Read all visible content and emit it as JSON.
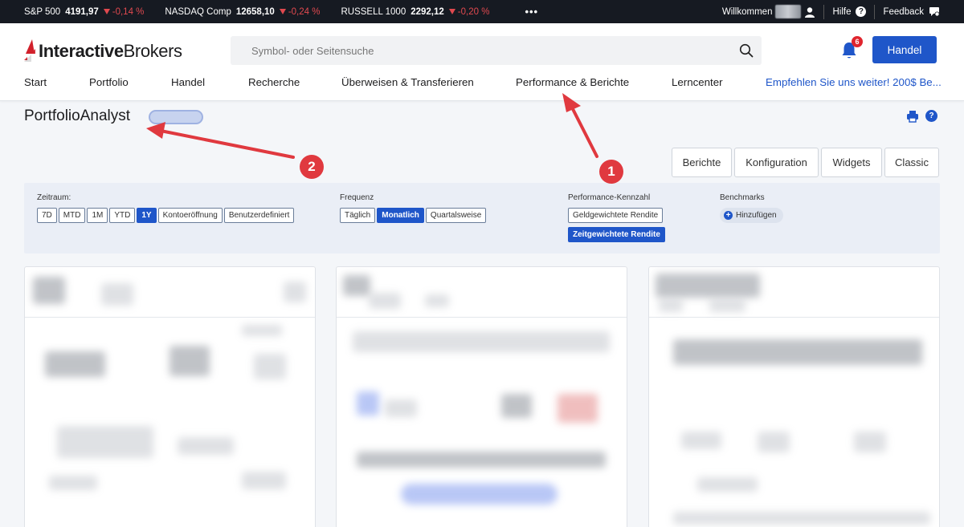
{
  "ticker": {
    "items": [
      {
        "name": "S&P 500",
        "value": "4191,97",
        "change": "-0,14 %"
      },
      {
        "name": "NASDAQ Comp",
        "value": "12658,10",
        "change": "-0,24 %"
      },
      {
        "name": "RUSSELL 1000",
        "value": "2292,12",
        "change": "-0,20 %"
      }
    ],
    "more": "•••",
    "welcome": "Willkommen",
    "help": "Hilfe",
    "feedback": "Feedback"
  },
  "header": {
    "logo_bold": "Interactive",
    "logo_regular": "Brokers",
    "search_placeholder": "Symbol- oder Seitensuche",
    "notification_count": "6",
    "trade_button": "Handel"
  },
  "nav": {
    "start": "Start",
    "portfolio": "Portfolio",
    "handel": "Handel",
    "recherche": "Recherche",
    "transfers": "Überweisen & Transferieren",
    "performance": "Performance & Berichte",
    "lerncenter": "Lerncenter",
    "promo": "Empfehlen Sie uns weiter! 200$ Be..."
  },
  "page": {
    "title": "PortfolioAnalyst"
  },
  "views": {
    "berichte": "Berichte",
    "konfiguration": "Konfiguration",
    "widgets": "Widgets",
    "classic": "Classic"
  },
  "filters": {
    "zeitraum_label": "Zeitraum:",
    "zeitraum_options": [
      "7D",
      "MTD",
      "1M",
      "YTD",
      "1Y",
      "Kontoeröffnung",
      "Benutzerdefiniert"
    ],
    "zeitraum_selected": "1Y",
    "frequenz_label": "Frequenz",
    "frequenz_options": [
      "Täglich",
      "Monatlich",
      "Quartalsweise"
    ],
    "frequenz_selected": "Monatlich",
    "kennzahl_label": "Performance-Kennzahl",
    "kennzahl_options": [
      "Geldgewichtete Rendite",
      "Zeitgewichtete Rendite"
    ],
    "kennzahl_selected": "Zeitgewichtete Rendite",
    "benchmarks_label": "Benchmarks",
    "benchmarks_add": "Hinzufügen"
  },
  "annotations": {
    "marker_1": "1",
    "marker_2": "2"
  },
  "colors": {
    "brand_blue": "#1f56c9",
    "ticker_bg": "#161a22",
    "negative": "#e0494f",
    "annotation_red": "#e0393f"
  }
}
